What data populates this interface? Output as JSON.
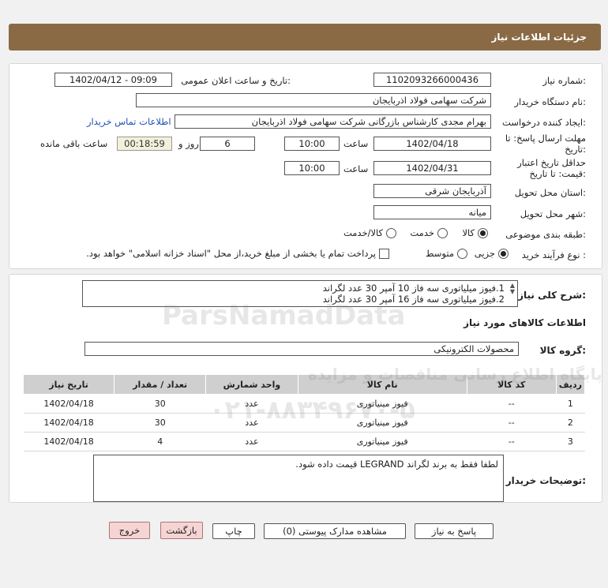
{
  "header": {
    "title": "جزئیات اطلاعات نیاز"
  },
  "info": {
    "need_number_label": "شماره نیاز:",
    "need_number": "1102093266000436",
    "announce_label": "تاریخ و ساعت اعلان عمومی:",
    "announce_value": "1402/04/12 - 09:09",
    "buyer_label": "نام دستگاه خریدار:",
    "buyer_value": "شرکت سهامی فولاد اذربایجان",
    "creator_label": "ایجاد کننده درخواست:",
    "creator_value": "بهرام مجدی کارشناس بازرگانی شرکت سهامی فولاد اذربایجان",
    "contact_link": "اطلاعات تماس خریدار",
    "deadline_label_1": "مهلت ارسال پاسخ: تا",
    "deadline_label_2": "تاریخ:",
    "deadline_date": "1402/04/18",
    "time_label": "ساعت",
    "deadline_time": "10:00",
    "days_value": "6",
    "days_label": "روز و",
    "remaining_time": "00:18:59",
    "remaining_label": "ساعت باقی مانده",
    "validity_label_1": "حداقل تاریخ اعتبار",
    "validity_label_2": "قیمت: تا تاریخ:",
    "validity_date": "1402/04/31",
    "validity_time_label": "ساعت",
    "validity_time": "10:00",
    "province_label": "استان محل تحویل:",
    "province_value": "آذربایجان شرقی",
    "city_label": "شهر محل تحویل:",
    "city_value": "میانه",
    "category_label": "طبقه بندی موضوعی:",
    "category_options": [
      "کالا",
      "خدمت",
      "کالا/خدمت"
    ],
    "process_label": "نوع فرآیند خرید :",
    "process_options": [
      "جزیی",
      "متوسط"
    ],
    "payment_note": "پرداخت تمام یا بخشی از مبلغ خرید،از محل \"اسناد خزانه اسلامی\" خواهد بود."
  },
  "summary": {
    "label": "شرح کلی نیاز:",
    "lines": [
      "1.فیوز میلیاتوری سه فاز 10 آمپر 30 عدد لگراند",
      "2.فیوز میلیاتوری سه فاز 16 آمپر 30 عدد لگراند"
    ],
    "goods_title": "اطلاعات کالاهای مورد نیاز",
    "group_label": "گروه کالا:",
    "group_value": "محصولات الکترونیکی"
  },
  "table": {
    "headers": [
      "ردیف",
      "کد کالا",
      "نام کالا",
      "واحد شمارش",
      "تعداد / مقدار",
      "تاریخ نیاز"
    ],
    "rows": [
      [
        "1",
        "--",
        "فیوز مینیاتوری",
        "عدد",
        "30",
        "1402/04/18"
      ],
      [
        "2",
        "--",
        "فیوز مینیاتوری",
        "عدد",
        "30",
        "1402/04/18"
      ],
      [
        "3",
        "--",
        "فیوز مینیاتوری",
        "عدد",
        "4",
        "1402/04/18"
      ]
    ]
  },
  "notes": {
    "label": "توضیحات خریدار:",
    "text": "لطفا فقط به برند لگراند LEGRAND قیمت داده شود."
  },
  "buttons": {
    "reply": "پاسخ به نیاز",
    "docs": "مشاهده مدارک پیوستی (0)",
    "print": "چاپ",
    "back": "بازگشت",
    "exit": "خروج"
  },
  "watermark": {
    "brand": "ParsNamadData",
    "line1": "پایگاه اطلاع رسانی مناقصات و مزایده",
    "phone": "۰۲۱-۸۸۳۴۹۶۷۰-۵"
  }
}
